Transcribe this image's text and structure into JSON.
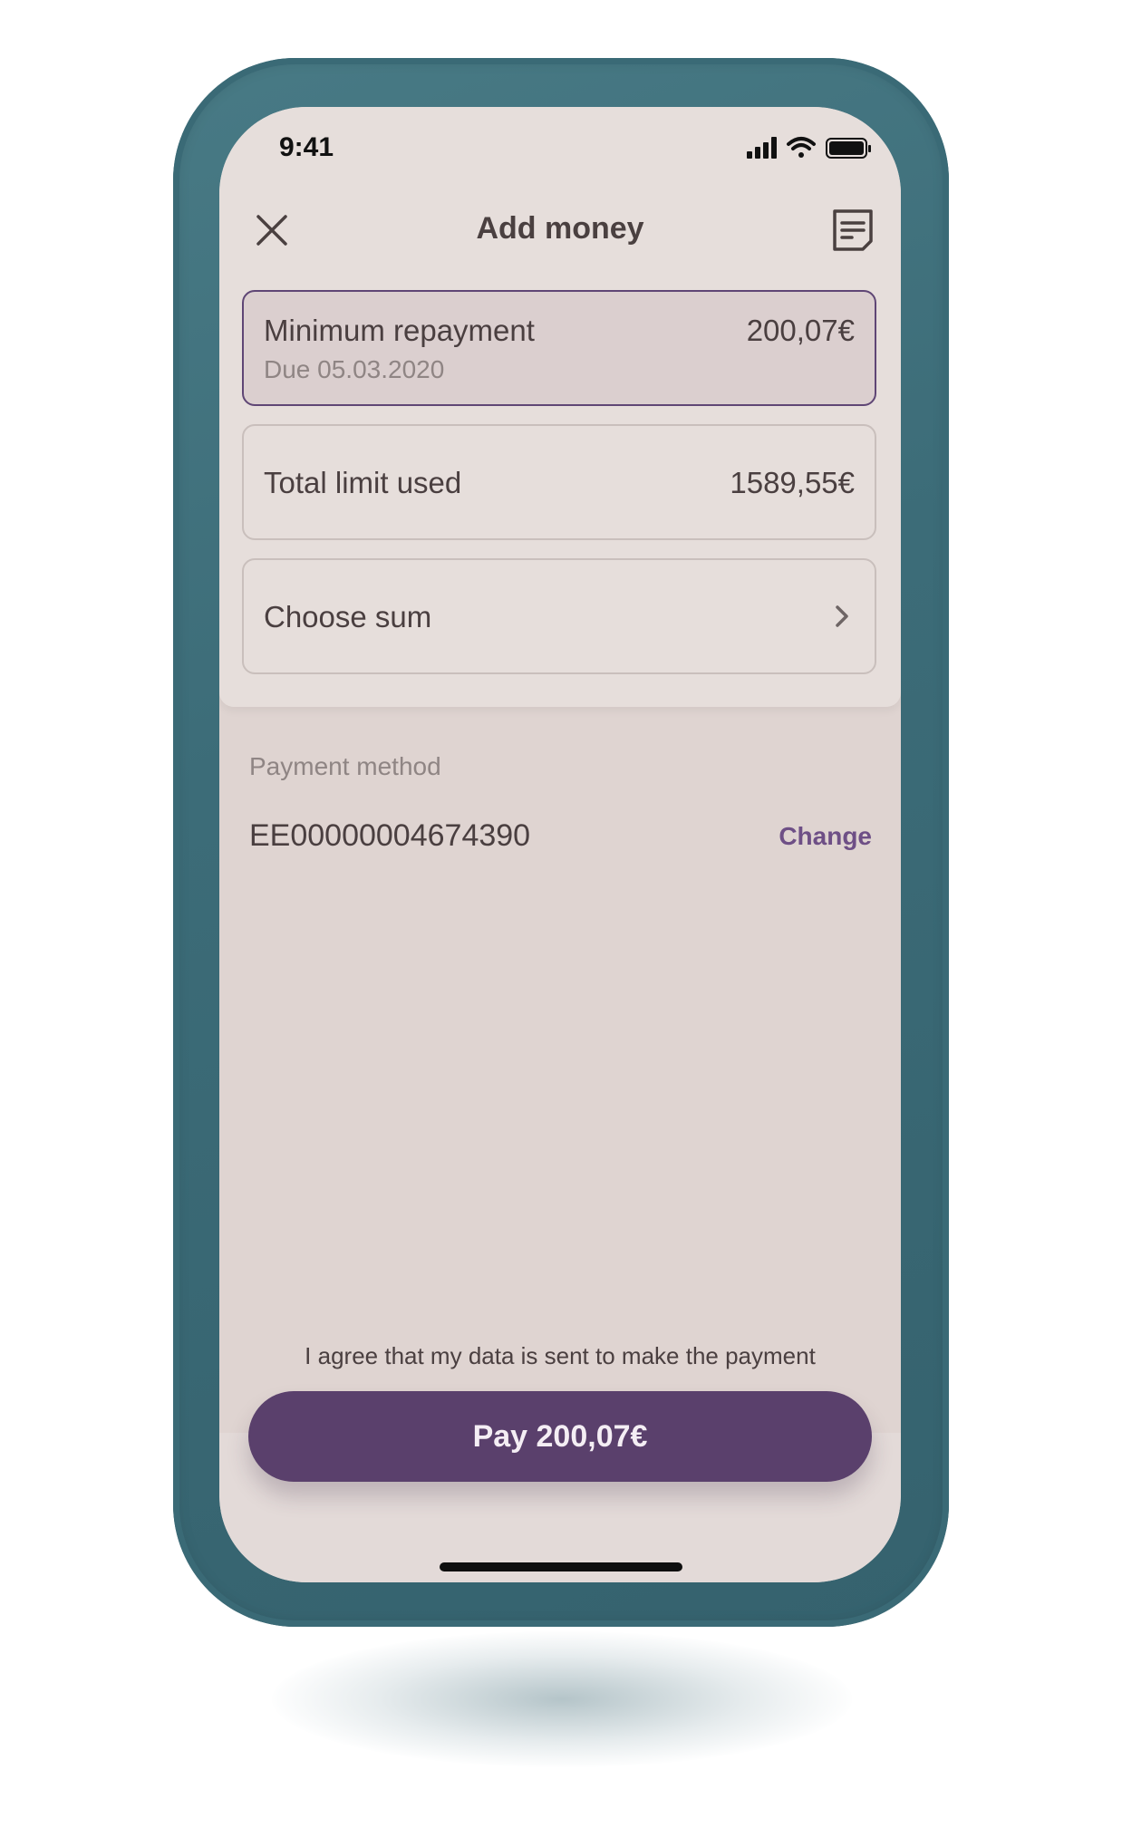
{
  "status_bar": {
    "time": "9:41"
  },
  "header": {
    "title": "Add money"
  },
  "options": [
    {
      "label": "Minimum repayment",
      "sublabel": "Due 05.03.2020",
      "amount": "200,07€"
    },
    {
      "label": "Total limit used",
      "amount": "1589,55€"
    },
    {
      "label": "Choose sum"
    }
  ],
  "payment": {
    "label": "Payment method",
    "account": "EE00000004674390",
    "change_label": "Change"
  },
  "footer": {
    "agreement": "I agree that my data is sent to make the payment",
    "pay_label": "Pay 200,07€"
  },
  "colors": {
    "accent": "#5a406c",
    "frame": "#3e6e7a",
    "screen_bg": "#dfd4d1"
  },
  "icons": [
    "close-icon",
    "document-icon",
    "chevron-right-icon",
    "signal-icon",
    "wifi-icon",
    "battery-icon"
  ]
}
